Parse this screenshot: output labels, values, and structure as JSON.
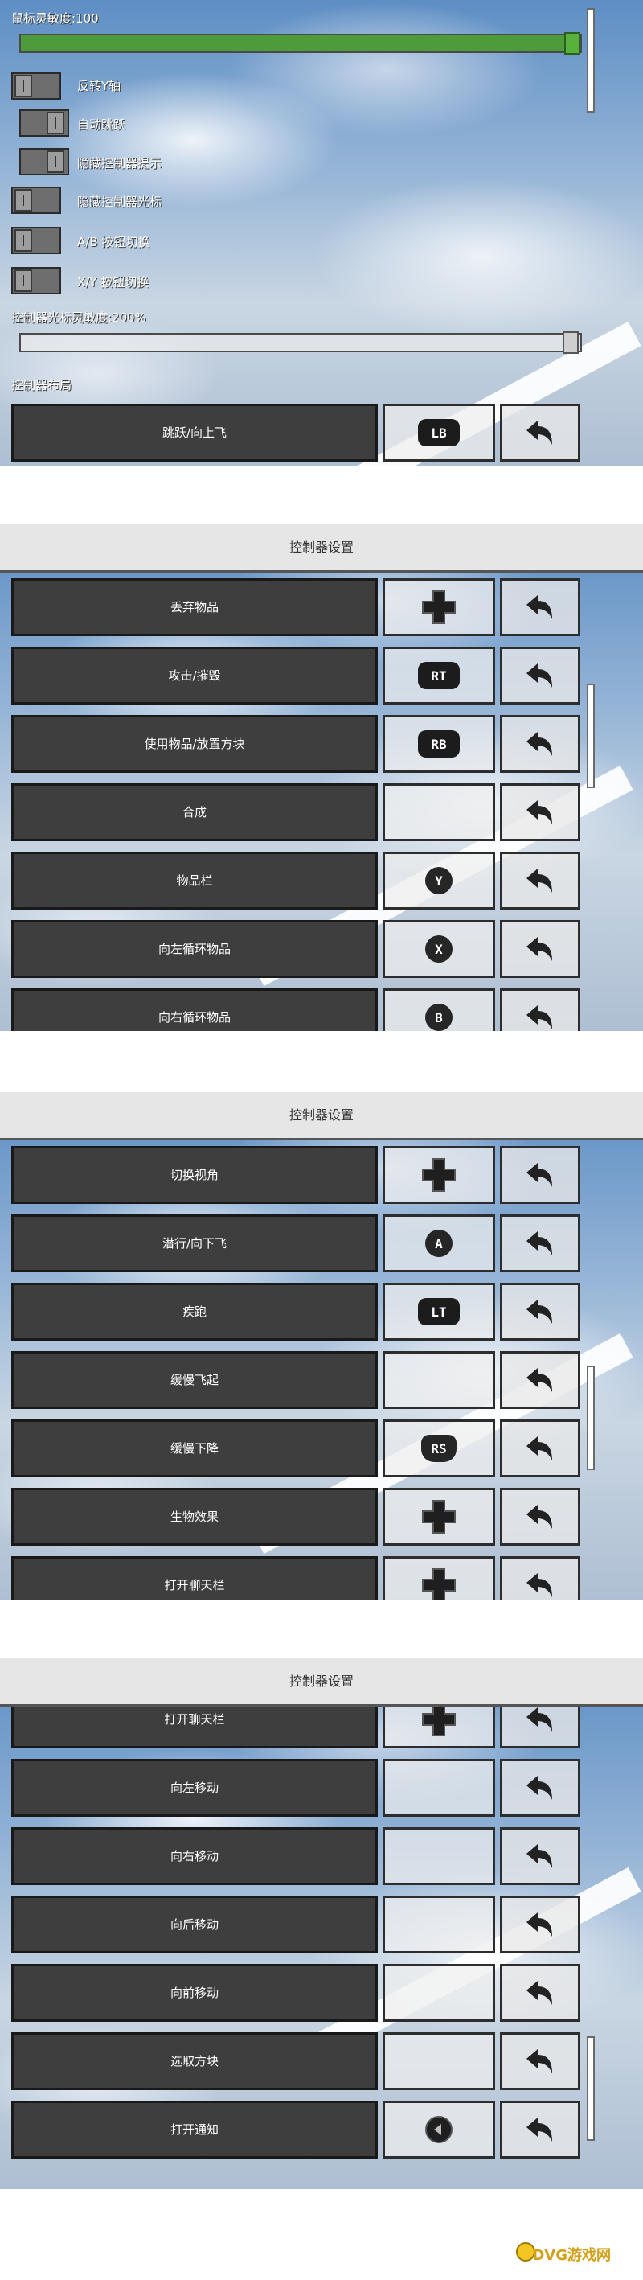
{
  "settings": {
    "mouse_sensitivity_label": "鼠标灵敏度:100",
    "mouse_sensitivity_value": 100,
    "toggles": [
      {
        "label": "反转Y轴",
        "on": false
      },
      {
        "label": "自动跳跃",
        "on": false
      },
      {
        "label": "隐藏控制器提示",
        "on": false
      },
      {
        "label": "隐藏控制器光标",
        "on": false
      },
      {
        "label": "A/B 按钮切换",
        "on": false
      },
      {
        "label": "X/Y 按钮切换",
        "on": false
      }
    ],
    "cursor_sensitivity_label": "控制器光标灵敏度:200%",
    "layout_heading": "控制器布局",
    "first_binding": {
      "label": "跳跃/向上飞",
      "glyph": "LB"
    }
  },
  "controller": {
    "title": "控制器设置",
    "pages": [
      [
        {
          "label": "丢弃物品",
          "glyph_type": "dpad",
          "glyph": ""
        },
        {
          "label": "攻击/摧毁",
          "glyph_type": "pill",
          "glyph": "RT"
        },
        {
          "label": "使用物品/放置方块",
          "glyph_type": "pill",
          "glyph": "RB"
        },
        {
          "label": "合成",
          "glyph_type": "none",
          "glyph": ""
        },
        {
          "label": "物品栏",
          "glyph_type": "circle",
          "glyph": "Y"
        },
        {
          "label": "向左循环物品",
          "glyph_type": "circle",
          "glyph": "X"
        },
        {
          "label": "向右循环物品",
          "glyph_type": "circle",
          "glyph": "B"
        }
      ],
      [
        {
          "label": "切换视角",
          "glyph_type": "dpad",
          "glyph": ""
        },
        {
          "label": "潜行/向下飞",
          "glyph_type": "circle",
          "glyph": "A"
        },
        {
          "label": "疾跑",
          "glyph_type": "pill",
          "glyph": "LT"
        },
        {
          "label": "缓慢飞起",
          "glyph_type": "none",
          "glyph": ""
        },
        {
          "label": "缓慢下降",
          "glyph_type": "rs",
          "glyph": "RS"
        },
        {
          "label": "生物效果",
          "glyph_type": "dpad",
          "glyph": ""
        },
        {
          "label": "打开聊天栏",
          "glyph_type": "dpad",
          "glyph": ""
        }
      ],
      [
        {
          "label": "打开聊天栏",
          "glyph_type": "dpad",
          "glyph": ""
        },
        {
          "label": "向左移动",
          "glyph_type": "none",
          "glyph": ""
        },
        {
          "label": "向右移动",
          "glyph_type": "none",
          "glyph": ""
        },
        {
          "label": "向后移动",
          "glyph_type": "none",
          "glyph": ""
        },
        {
          "label": "向前移动",
          "glyph_type": "none",
          "glyph": ""
        },
        {
          "label": "选取方块",
          "glyph_type": "none",
          "glyph": ""
        },
        {
          "label": "打开通知",
          "glyph_type": "stick",
          "glyph": ""
        }
      ]
    ]
  },
  "watermark": "DVG游戏网",
  "colors": {
    "accent_green": "#4d9b3a",
    "button_dark": "#3e3e3e",
    "header_bg": "#e6e6e6"
  },
  "icons": {
    "reset": "back-arrow-icon",
    "dpad": "dpad-icon",
    "stick": "left-stick-icon"
  }
}
